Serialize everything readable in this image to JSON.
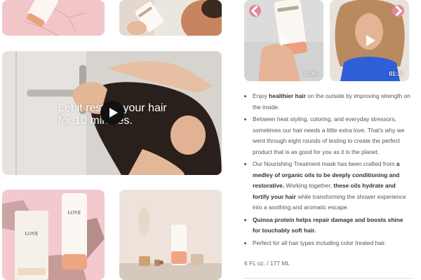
{
  "gallery": {
    "main_video_overlay_text": [
      "Let it rest on your hair",
      "for 10 minutes."
    ],
    "thumbnails": [
      {
        "label": "product on pink marble"
      },
      {
        "label": "hand holding tube in bathroom"
      },
      {
        "label": "hair treatment video"
      },
      {
        "label": "product with pink rocks"
      },
      {
        "label": "product on bathroom shelf"
      }
    ]
  },
  "videos": [
    {
      "duration": "00:45"
    },
    {
      "duration": "01:36"
    }
  ],
  "description": {
    "bullets": [
      [
        {
          "t": "Enjoy ",
          "b": false
        },
        {
          "t": "healthier hair",
          "b": true
        },
        {
          "t": " on the outside by improving strength on the inside.",
          "b": false
        }
      ],
      [
        {
          "t": "Between heat styling, coloring, and everyday stressors, sometimes our hair needs a little extra love. That's why we went through eight rounds of testing to create the perfect product that is as good for you as it is the planet.",
          "b": false
        }
      ],
      [
        {
          "t": "Our Nourishing Treatment mask has been crafted from ",
          "b": false
        },
        {
          "t": "a medley of organic oils to be deeply conditioning and restorative.",
          "b": true
        },
        {
          "t": " Working together, ",
          "b": false
        },
        {
          "t": "these oils hydrate and fortify your hair",
          "b": true
        },
        {
          "t": " while transforming the shower experience into a soothing and aromatic escape.",
          "b": false
        }
      ],
      [
        {
          "t": "Quinoa protein helps repair damage and boosts shine for touchably soft hair.",
          "b": true
        }
      ],
      [
        {
          "t": "Perfect for all hair types including color treated hair.",
          "b": false
        }
      ]
    ],
    "size": "6 FL oz. / 177 ML"
  },
  "brand": "LOVE",
  "colors": {
    "accent_pink": "#e08a9a",
    "text": "#555555",
    "bold_text": "#333333"
  },
  "icons": {
    "play": "play-icon",
    "prev": "chevron-left-icon",
    "next": "chevron-right-icon"
  }
}
